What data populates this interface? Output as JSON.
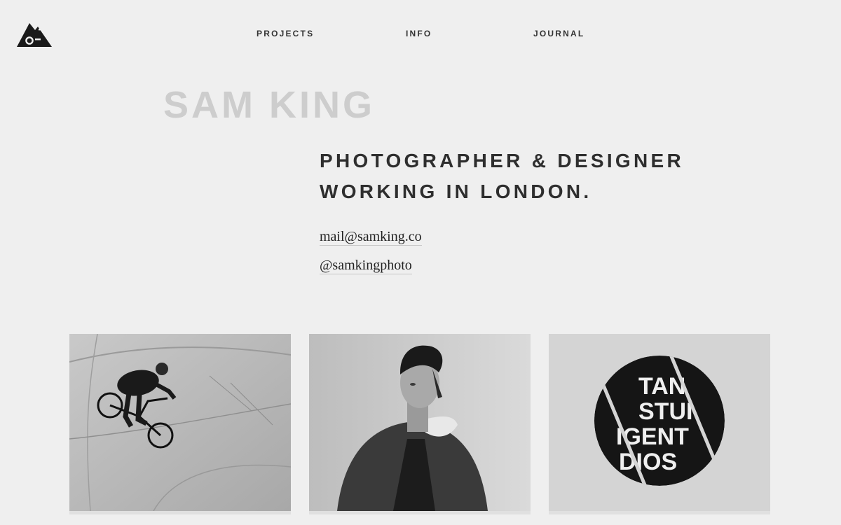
{
  "logo": {
    "icon": "mountain-camera-icon"
  },
  "nav": {
    "items": [
      "PROJECTS",
      "INFO",
      "JOURNAL"
    ]
  },
  "hero": {
    "name": "SAM KING",
    "tagline_line1": "PHOTOGRAPHER & DESIGNER",
    "tagline_line2": "WORKING IN LONDON."
  },
  "contact": {
    "email": "mail@samking.co",
    "handle": "@samkingphoto"
  },
  "projects": [
    {
      "subject": "bmx-rider-photo"
    },
    {
      "subject": "portrait-photo"
    },
    {
      "subject": "logo-badge",
      "badge_lines": [
        "TAN",
        "STUI",
        "IGENT",
        "DIOS"
      ]
    }
  ],
  "colors": {
    "background": "#efefef",
    "name": "#cdcdcd",
    "text": "#2e2e2e"
  }
}
